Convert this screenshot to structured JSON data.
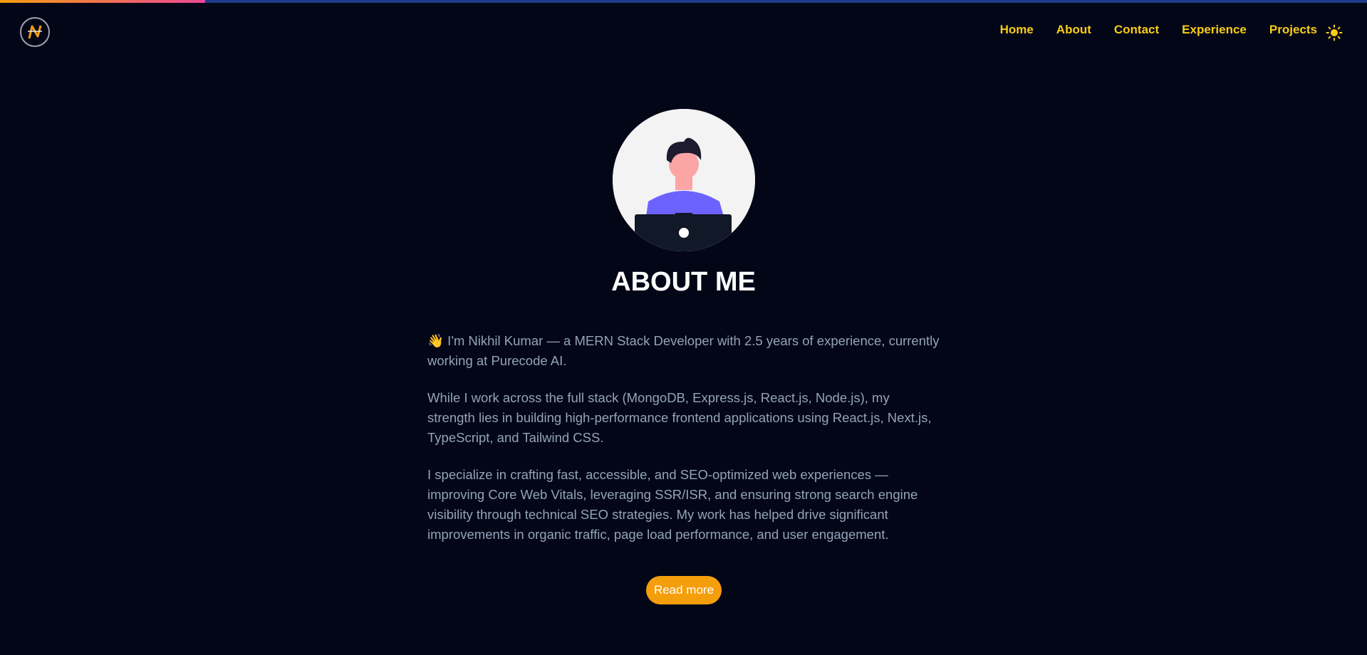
{
  "scroll_progress": 0.15,
  "colors": {
    "background": "#020617",
    "accent": "#facc15",
    "button": "#f59e0b",
    "body_text": "#94a3b8",
    "progress_track": "#1e3a8a"
  },
  "header": {
    "logo_icon": "nk-monogram-logo",
    "nav": [
      "Home",
      "About",
      "Contact",
      "Experience",
      "Projects"
    ],
    "theme_icon": "sun-icon"
  },
  "about": {
    "avatar_icon": "developer-illustration",
    "title": "ABOUT ME",
    "paragraphs": [
      "👋 I'm Nikhil Kumar — a MERN Stack Developer with 2.5 years of experience, currently working at Purecode AI.",
      "While I work across the full stack (MongoDB, Express.js, React.js, Node.js), my strength lies in building high-performance frontend applications using React.js, Next.js, TypeScript, and Tailwind CSS.",
      "I specialize in crafting fast, accessible, and SEO-optimized web experiences — improving Core Web Vitals, leveraging SSR/ISR, and ensuring strong search engine visibility through technical SEO strategies. My work has helped drive significant improvements in organic traffic, page load performance, and user engagement."
    ],
    "button_label": "Read more"
  }
}
